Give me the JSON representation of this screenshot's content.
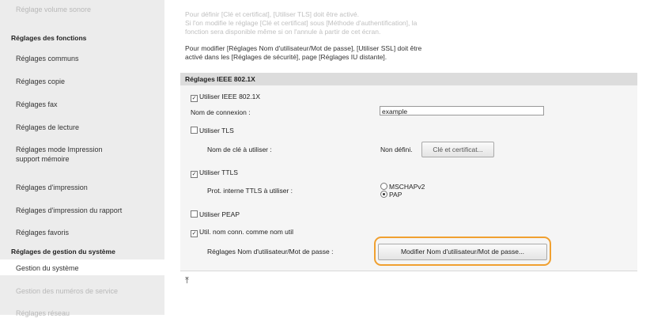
{
  "sidebar": {
    "top_faded": "Réglage volume sonore",
    "section_functions": "Réglages des fonctions",
    "items": [
      "Réglages communs",
      "Réglages copie",
      "Réglages fax",
      "Réglages de lecture",
      "Réglages mode Impression",
      "support mémoire",
      "Réglages d'impression",
      "Réglages d'impression du rapport",
      "Réglages favoris"
    ],
    "section_system": "Réglages de gestion du système",
    "system_items": [
      "Gestion du système",
      "Gestion des numéros de service",
      "Réglages réseau"
    ]
  },
  "notes": {
    "line0": "",
    "line1": "Pour définir [Clé et certificat], [Utiliser TLS] doit être activé.",
    "line2": "Si l'on modifie le réglage [Clé et certificat] sous [Méthode d'authentification], la",
    "line3": "fonction sera disponible même si on l'annule à partir de cet écran.",
    "line4": "Pour modifier [Réglages Nom d'utilisateur/Mot de passe], [Utiliser SSL] doit être",
    "line5": "activé dans les [Réglages de sécurité], page [Réglages IU distante]."
  },
  "panel": {
    "title": "Réglages IEEE 802.1X",
    "use_ieee": "Utiliser IEEE 802.1X",
    "use_ieee_checked": true,
    "login_label": "Nom de connexion :",
    "login_value": "example",
    "use_tls": "Utiliser TLS",
    "use_tls_checked": false,
    "key_label": "Nom de clé à utiliser :",
    "key_value": "Non défini.",
    "key_button": "Clé et certificat...",
    "use_ttls": "Utiliser TTLS",
    "use_ttls_checked": true,
    "ttls_protocol_label": "Prot. interne TTLS à utiliser :",
    "ttls_options": [
      "MSCHAPv2",
      "PAP"
    ],
    "ttls_selected": "PAP",
    "use_peap": "Utiliser PEAP",
    "use_peap_checked": false,
    "use_login_as_user": "Util. nom conn. comme nom util",
    "use_login_as_user_checked": true,
    "credentials_label": "Réglages Nom d'utilisateur/Mot de passe :",
    "credentials_button": "Modifier Nom d'utilisateur/Mot de passe..."
  },
  "footer": {
    "top_icon": "scroll-to-top-icon"
  },
  "colors": {
    "highlight": "#f0a030",
    "sidebar_bg": "#ececec",
    "panel_header_bg": "#dcdcdc"
  }
}
